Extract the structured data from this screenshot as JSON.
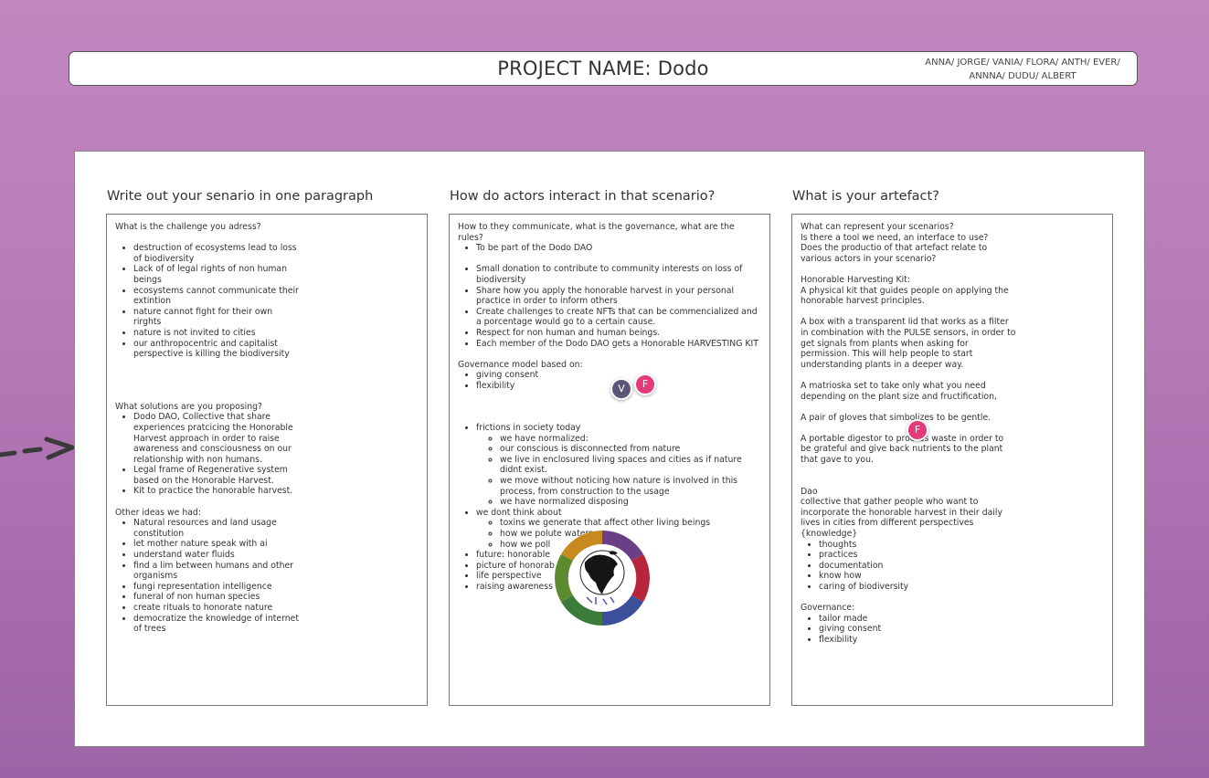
{
  "header": {
    "title": "PROJECT NAME: Dodo",
    "team_line1": "ANNA/ JORGE/ VANIA/ FLORA/ ANTH/ EVER/",
    "team_line2": "ANNNA/ DUDU/ ALBERT"
  },
  "columns": {
    "scenario": {
      "heading": "Write out your senario in one paragraph",
      "challenge_q": "What is the challenge you adress?",
      "challenges": [
        "destruction of ecosystems lead to loss of biodiversity",
        "Lack of of legal rights of non human beings",
        "ecosystems cannot communicate their extintion",
        "nature cannot fight for their own rirghts",
        "nature is not invited to cities",
        "our anthropocentric and capitalist perspective is killing the biodiversity"
      ],
      "solutions_q": "What solutions are you proposing?",
      "solutions": [
        "Dodo DAO, Collective that share experiences pratcicing the Honorable Harvest approach in order to raise awareness and consciousness on our relationship with non humans.",
        "Legal frame of Regenerative system based on the Honorable Harvest.",
        "Kit to practice the honorable harvest."
      ],
      "other_q": "Other ideas we had:",
      "other": [
        "Natural resources and land usage constitution",
        "let mother nature speak with ai",
        "understand water fluids",
        "find a lim between humans and other organisms",
        "fungi representation intelligence",
        "funeral of non human species",
        "create rituals to honorate nature",
        "democratize the knowledge of internet of trees"
      ]
    },
    "actors": {
      "heading": "How do actors interact in that scenario?",
      "intro": "How to they communicate, what is the governance, what are the rules?",
      "rule0": "To be part of the Dodo DAO",
      "rules": [
        "Small donation to contribute to community interests on loss of biodiversity",
        "Share how you apply the honorable harvest in your personal practice in order to inform others",
        "Create challenges to create NFTs that can be commencialized and a porcentage would go to a certain cause.",
        "Respect for non human and human beings.",
        "Each member of the Dodo DAO gets a Honorable HARVESTING KIT"
      ],
      "gov_title": "Governance model based on:",
      "gov": [
        "giving consent",
        "flexibility"
      ],
      "frictions": "frictions in society today",
      "frictions_sub": [
        "we have normalized:",
        "our conscious is disconnected from nature",
        "we live in enclosured living spaces and cities as if nature didnt exist.",
        "we move without noticing how nature is involved in this process, from construction to the usage",
        "we have normalized disposing"
      ],
      "dont": "we dont think about",
      "dont_sub": [
        "toxins we generate that affect other living beings",
        "how we polute waters",
        "how we poll"
      ],
      "more": [
        "future: honorable",
        "picture of honorab",
        "life perspective",
        "raising awareness"
      ]
    },
    "artefact": {
      "heading": "What is your artefact?",
      "q1": "What can represent your scenarios?",
      "q2": "Is there a tool we need, an interface to use?",
      "q3": "Does the productio of that artefact relate to",
      "q4": "various actors in your scenario?",
      "kit_title": "Honorable Harvesting Kit:",
      "kit1": "A physical kit that guides people on applying the",
      "kit2": "honorable harvest principles.",
      "box1": "A box with a transparent lid that works as a filter",
      "box2": "in combination with the PULSE sensors, in order to",
      "box3": "get signals from plants when asking for",
      "box4": "permission. This will help people to start",
      "box5": "understanding plants in a deeper way.",
      "mat1": "A matrioska set to take only what you need",
      "mat2": "depending on the plant size and fructification,",
      "gloves": "A pair of gloves that simbolizes to be gentle.",
      "dig1": "A portable digestor to process waste in order to",
      "dig2": "be grateful and give back nutrients to the plant",
      "dig3": "that gave to you.",
      "dao_title": "Dao",
      "dao1": "collective that gather people who want to",
      "dao2": "incorporate the honorable harvest in their daily",
      "dao3": "lives in cities from different perspectives",
      "dao4": "{knowledge}",
      "dao_items": [
        "thoughts",
        "practices",
        "documentation",
        "know how",
        "caring of biodiversity"
      ],
      "gov_title": "Governance:",
      "gov": [
        "tailor made",
        "giving consent",
        "flexibility"
      ]
    }
  },
  "cursors": {
    "v": "V",
    "f1": "F",
    "f2": "F"
  },
  "colors": {
    "accent_cursor": "#e43a7a",
    "cursor_v": "#5d5577"
  }
}
